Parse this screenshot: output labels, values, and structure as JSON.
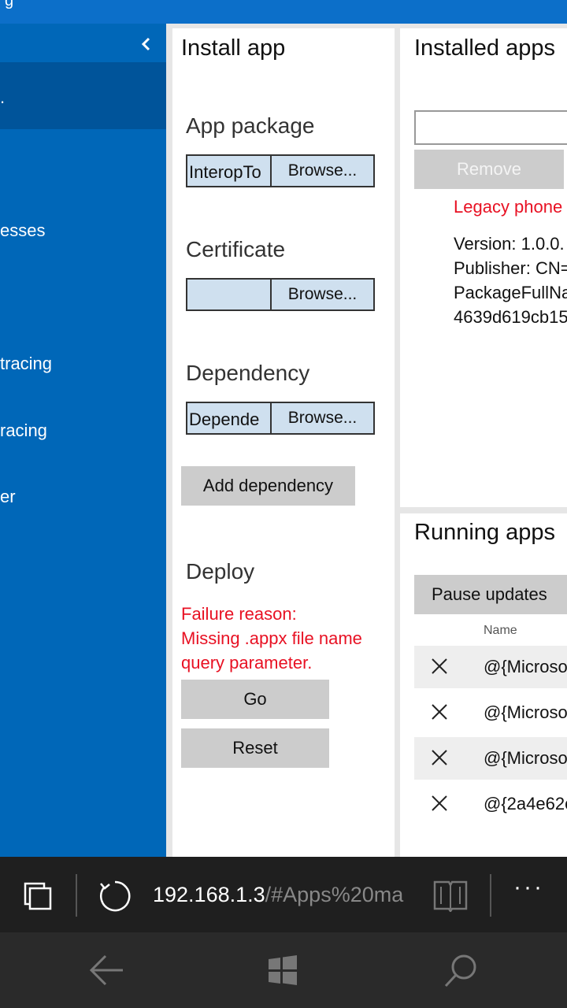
{
  "sidebar": {
    "items": [
      {
        "label": "esses"
      },
      {
        "label": "tracing"
      },
      {
        "label": "racing"
      },
      {
        "label": "er"
      }
    ]
  },
  "install": {
    "title": "Install app",
    "app_package": {
      "heading": "App package",
      "value": "InteropTo",
      "browse": "Browse..."
    },
    "certificate": {
      "heading": "Certificate",
      "value": "",
      "browse": "Browse..."
    },
    "dependency": {
      "heading": "Dependency",
      "value": "Depende",
      "browse": "Browse..."
    },
    "add_dependency": "Add dependency",
    "deploy_heading": "Deploy",
    "error_lines": [
      "Failure reason:",
      "Missing .appx file name",
      "query parameter."
    ],
    "go": "Go",
    "reset": "Reset"
  },
  "installed": {
    "title": "Installed apps",
    "remove": "Remove",
    "legacy_label": "Legacy phone",
    "details": [
      "Version: 1.0.0.",
      "Publisher: CN=",
      "PackageFullNa",
      "4639d619cb15"
    ]
  },
  "running": {
    "title": "Running apps",
    "pause": "Pause updates",
    "column_name": "Name",
    "rows": [
      {
        "name": "@{Microso"
      },
      {
        "name": "@{Microso"
      },
      {
        "name": "@{Microso"
      },
      {
        "name": "@{2a4e62c"
      }
    ]
  },
  "browser": {
    "url_host": "192.168.1.3",
    "url_path": "/#Apps%20ma"
  },
  "colors": {
    "sidebar": "#0067b8",
    "sidebar_selected": "#00549a",
    "error": "#e81123",
    "field": "#cfe0ef",
    "button": "#cccccc"
  }
}
